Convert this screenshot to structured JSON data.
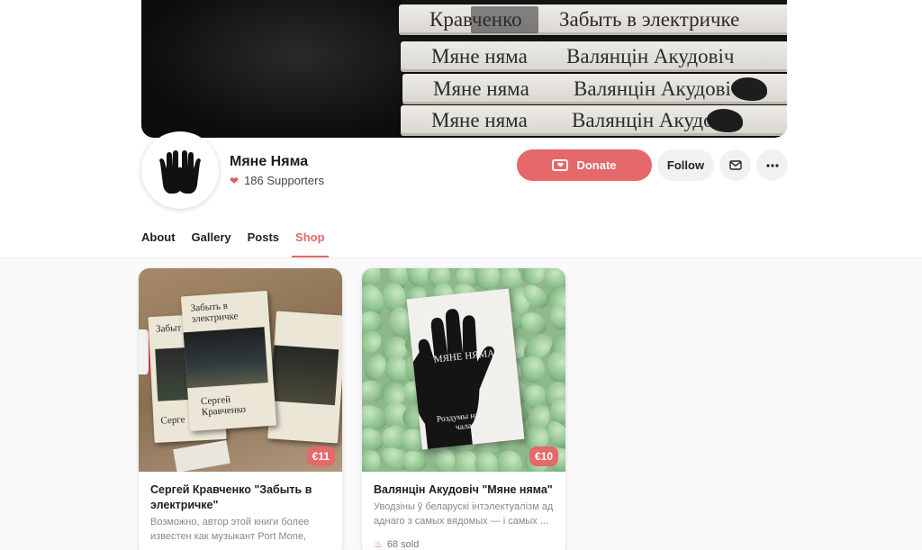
{
  "cover": {
    "spines": [
      {
        "left": "Кравченко",
        "right": "Забыть в электричке"
      },
      {
        "left": "Мяне няма",
        "right": "Валянцін Акудовіч"
      },
      {
        "left": "Мяне няма",
        "right": "Валянцін Акудовіч"
      },
      {
        "left": "Мяне няма",
        "right": "Валянцін Акудовіч"
      }
    ]
  },
  "profile": {
    "name": "Мяне Няма",
    "supporters": "186 Supporters"
  },
  "actions": {
    "donate_label": "Donate",
    "follow_label": "Follow"
  },
  "tabs": [
    {
      "label": "About",
      "active": false
    },
    {
      "label": "Gallery",
      "active": false
    },
    {
      "label": "Posts",
      "active": false
    },
    {
      "label": "Shop",
      "active": true
    }
  ],
  "shop": {
    "items": [
      {
        "title": "Сергей Кравченко \"Забыть в электричке\"",
        "description": "Возможно, автор этой книги более известен как музыкант Port Mone, Poly...",
        "price": "€11",
        "book_title": "Забыть в электричке",
        "book_author": "Сергей Кравченко",
        "back_book_title": "Забыт",
        "back_book_author": "Серге"
      },
      {
        "title": "Валянцін Акудовіч \"Мяне няма\"",
        "description": "Уводзіны ў беларускі інтэлектуалізм ад аднаго з самых вядомых — і самых ...",
        "price": "€10",
        "sold": "68 sold",
        "book_author": "Валянцін Акудовіч",
        "book_title": "МЯНЕ НЯМА",
        "book_subtitle": "Роздумы на руінах чалавека"
      }
    ]
  },
  "colors": {
    "accent": "#e5686a",
    "text": "#222222",
    "muted": "#888888"
  },
  "icons": {
    "supporters": "heart-icon",
    "donate": "donate-heart-icon",
    "mail": "mail-icon",
    "more": "more-dots-icon",
    "sold": "fire-icon"
  }
}
